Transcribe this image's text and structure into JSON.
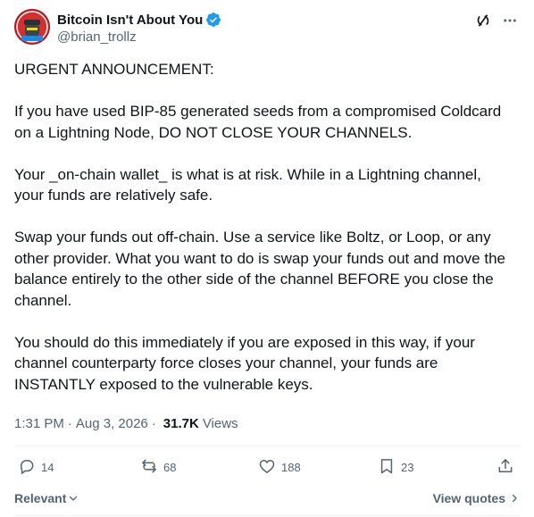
{
  "author": {
    "display_name": "Bitcoin Isn't About You",
    "handle": "@brian_trollz",
    "verified_icon": "verified-badge-icon"
  },
  "header_actions": {
    "grok_icon": "grok-icon",
    "more_icon": "more-icon"
  },
  "post": {
    "paragraphs": [
      "URGENT ANNOUNCEMENT:",
      "If you have used BIP-85 generated seeds from a compromised Coldcard on a Lightning Node, DO NOT CLOSE YOUR CHANNELS.",
      "Your _on-chain wallet_ is what is at risk. While in a Lightning channel, your funds are relatively safe.",
      "Swap your funds out off-chain. Use a service like Boltz, or Loop, or any other provider. What you want to do is swap your funds out and move the balance entirely to the other side of the channel BEFORE you close the channel.",
      "You should do this immediately if you are exposed in this way, if your channel counterparty force closes your channel, your funds are INSTANTLY exposed to the vulnerable keys."
    ]
  },
  "meta": {
    "time": "1:31 PM",
    "separator": "·",
    "date": "Aug 3, 2026",
    "views_count": "31.7K",
    "views_label": "Views"
  },
  "actions": {
    "replies": "14",
    "reposts": "68",
    "likes": "188",
    "bookmarks": "23"
  },
  "footer": {
    "sort_label": "Relevant",
    "quotes_label": "View quotes"
  },
  "colors": {
    "text": "#0f1419",
    "secondary": "#536471",
    "verified": "#1d9bf0",
    "divider": "#eff3f4"
  }
}
